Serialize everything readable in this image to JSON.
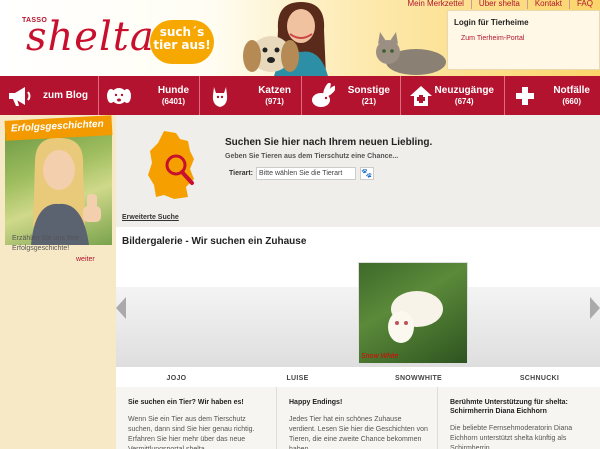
{
  "header": {
    "logo_tag": "TASSO",
    "logo_word": "shelta",
    "slogan": [
      "such´s",
      "tier aus!"
    ],
    "top_links": [
      "Mein Merkzettel",
      "Über shelta",
      "Kontakt",
      "FAQ"
    ],
    "login_title": "Login für Tierheime",
    "login_link": "Zum Tierheim-Portal"
  },
  "nav": {
    "items": [
      {
        "label": "zum Blog",
        "count": "",
        "icon": "megaphone-icon"
      },
      {
        "label": "Hunde",
        "count": "(6401)",
        "icon": "dog-icon"
      },
      {
        "label": "Katzen",
        "count": "(971)",
        "icon": "cat-icon"
      },
      {
        "label": "Sonstige",
        "count": "(21)",
        "icon": "rabbit-icon"
      },
      {
        "label": "Neuzugänge",
        "count": "(674)",
        "icon": "house-icon"
      },
      {
        "label": "Notfälle",
        "count": "(660)",
        "icon": "plus-icon"
      }
    ]
  },
  "sidebar": {
    "badge": "Erfolgsgeschichten",
    "text": "Erzählen Sie uns Ihre Erfolgsgeschichte!",
    "more": "weiter"
  },
  "search": {
    "title": "Suchen Sie hier nach Ihrem neuen Liebling.",
    "subtitle": "Geben Sie Tieren aus dem Tierschutz eine Chance...",
    "tierart_label": "Tierart:",
    "tierart_value": "Bitte wählen Sie die Tierart",
    "advanced": "Erweiterte Suche"
  },
  "gallery": {
    "title": "Bildergalerie - Wir suchen ein Zuhause",
    "photo_caption": "Snow White",
    "names": [
      "JOJO",
      "LUISE",
      "SNOWWHITE",
      "SCHNUCKI"
    ]
  },
  "bottom": {
    "columns": [
      {
        "title": "Sie suchen ein Tier? Wir haben es!",
        "text": "Wenn Sie ein Tier aus dem Tierschutz suchen, dann sind Sie hier genau richtig. Erfahren Sie hier mehr über das neue Vermittlungsportal shelta."
      },
      {
        "title": "Happy Endings!",
        "text": "Jedes Tier hat ein schönes Zuhause verdient. Lesen Sie hier die Geschichten von Tieren, die eine zweite Chance bekommen haben."
      },
      {
        "title": "Berühmte Unterstützung für shelta: Schirmherrin Diana Eichhorn",
        "text": "Die beliebte Fernsehmoderatorin Diana Eichhorn unterstützt shelta künftig als Schirmherrin."
      }
    ]
  },
  "colors": {
    "brand_red": "#b3132f",
    "accent_orange": "#f7a800",
    "sidebar_bg": "#f7e9c6"
  }
}
